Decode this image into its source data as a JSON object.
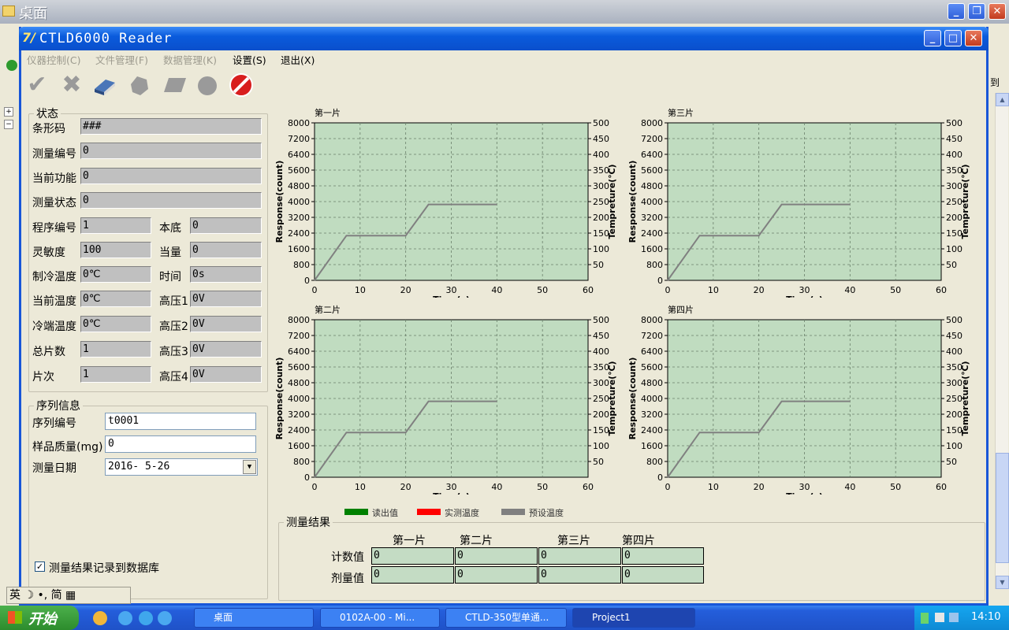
{
  "desktop": {
    "title": "桌面"
  },
  "app": {
    "title": "CTLD6000 Reader",
    "logo": "7/",
    "menu": [
      {
        "label": "仪器控制(C)",
        "enabled": false
      },
      {
        "label": "文件管理(F)",
        "enabled": false
      },
      {
        "label": "数据管理(K)",
        "enabled": false
      },
      {
        "label": "设置(S)",
        "enabled": true
      },
      {
        "label": "退出(X)",
        "enabled": true
      }
    ],
    "toolbar": [
      "check-icon",
      "cross-icon",
      "eraser-icon",
      "hand-icon",
      "plate-icon",
      "gear-icon",
      "stop-icon"
    ]
  },
  "status": {
    "legend": "状态",
    "fields": {
      "barcode": {
        "label": "条形码",
        "value": "###"
      },
      "measure_no": {
        "label": "测量编号",
        "value": "0"
      },
      "function": {
        "label": "当前功能",
        "value": "0"
      },
      "measure_state": {
        "label": "测量状态",
        "value": "0"
      },
      "program_no": {
        "label": "程序编号",
        "value": "1"
      },
      "background": {
        "label": "本底",
        "value": "0"
      },
      "sensitivity": {
        "label": "灵敏度",
        "value": "100"
      },
      "equivalent": {
        "label": "当量",
        "value": "0"
      },
      "cool_temp": {
        "label": "制冷温度",
        "value": "0℃"
      },
      "time": {
        "label": "时间",
        "value": "0s"
      },
      "cur_temp": {
        "label": "当前温度",
        "value": "0℃"
      },
      "hv1": {
        "label": "高压1",
        "value": "0V"
      },
      "cold_temp": {
        "label": "冷端温度",
        "value": "0℃"
      },
      "hv2": {
        "label": "高压2",
        "value": "0V"
      },
      "total": {
        "label": "总片数",
        "value": "1"
      },
      "hv3": {
        "label": "高压3",
        "value": "0V"
      },
      "piece": {
        "label": "片次",
        "value": "1"
      },
      "hv4": {
        "label": "高压4",
        "value": "0V"
      }
    }
  },
  "sequence": {
    "legend": "序列信息",
    "serial_label": "序列编号",
    "serial_value": "t0001",
    "mass_label": "样品质量(mg)",
    "mass_value": "0",
    "date_label": "测量日期",
    "date_value": "2016- 5-26"
  },
  "db_checkbox": {
    "label": "测量结果记录到数据库",
    "checked": true
  },
  "chart_data": [
    {
      "type": "line",
      "title": "第一片",
      "xlabel": "Time(s)",
      "ylabel": "Response(count)",
      "y2label": "Tempreture(℃)",
      "xlim": [
        0,
        60
      ],
      "ylim": [
        0,
        8000
      ],
      "y2lim": [
        0,
        500
      ],
      "xticks": [
        "0",
        "10",
        "20",
        "30",
        "40",
        "50",
        "60"
      ],
      "yticks": [
        "0",
        "800",
        "1600",
        "2400",
        "3200",
        "4000",
        "4800",
        "5600",
        "6400",
        "7200",
        "8000"
      ],
      "y2ticks": [
        "50",
        "100",
        "150",
        "200",
        "250",
        "300",
        "350",
        "400",
        "450",
        "500"
      ],
      "series": [
        {
          "name": "预设温度",
          "color": "#808080",
          "x": [
            0,
            7,
            20,
            25,
            40
          ],
          "y": [
            0,
            142,
            142,
            241,
            241
          ]
        }
      ]
    },
    {
      "type": "line",
      "title": "第三片",
      "xlabel": "Time(s)",
      "ylabel": "Response(count)",
      "y2label": "Tempreture(℃)",
      "xlim": [
        0,
        60
      ],
      "ylim": [
        0,
        8000
      ],
      "y2lim": [
        0,
        500
      ],
      "xticks": [
        "0",
        "10",
        "20",
        "30",
        "40",
        "50",
        "60"
      ],
      "yticks": [
        "0",
        "800",
        "1600",
        "2400",
        "3200",
        "4000",
        "4800",
        "5600",
        "6400",
        "7200",
        "8000"
      ],
      "y2ticks": [
        "50",
        "100",
        "150",
        "200",
        "250",
        "300",
        "350",
        "400",
        "450",
        "500"
      ],
      "series": [
        {
          "name": "预设温度",
          "color": "#808080",
          "x": [
            0,
            7,
            20,
            25,
            40
          ],
          "y": [
            0,
            142,
            142,
            241,
            241
          ]
        }
      ]
    },
    {
      "type": "line",
      "title": "第二片",
      "xlabel": "Time(s)",
      "ylabel": "Response(count)",
      "y2label": "Tempreture(℃)",
      "xlim": [
        0,
        60
      ],
      "ylim": [
        0,
        8000
      ],
      "y2lim": [
        0,
        500
      ],
      "xticks": [
        "0",
        "10",
        "20",
        "30",
        "40",
        "50",
        "60"
      ],
      "yticks": [
        "0",
        "800",
        "1600",
        "2400",
        "3200",
        "4000",
        "4800",
        "5600",
        "6400",
        "7200",
        "8000"
      ],
      "y2ticks": [
        "50",
        "100",
        "150",
        "200",
        "250",
        "300",
        "350",
        "400",
        "450",
        "500"
      ],
      "series": [
        {
          "name": "预设温度",
          "color": "#808080",
          "x": [
            0,
            7,
            20,
            25,
            40
          ],
          "y": [
            0,
            142,
            142,
            241,
            241
          ]
        }
      ]
    },
    {
      "type": "line",
      "title": "第四片",
      "xlabel": "Time(s)",
      "ylabel": "Response(count)",
      "y2label": "Tempreture(℃)",
      "xlim": [
        0,
        60
      ],
      "ylim": [
        0,
        8000
      ],
      "y2lim": [
        0,
        500
      ],
      "xticks": [
        "0",
        "10",
        "20",
        "30",
        "40",
        "50",
        "60"
      ],
      "yticks": [
        "0",
        "800",
        "1600",
        "2400",
        "3200",
        "4000",
        "4800",
        "5600",
        "6400",
        "7200",
        "8000"
      ],
      "y2ticks": [
        "50",
        "100",
        "150",
        "200",
        "250",
        "300",
        "350",
        "400",
        "450",
        "500"
      ],
      "series": [
        {
          "name": "预设温度",
          "color": "#808080",
          "x": [
            0,
            7,
            20,
            25,
            40
          ],
          "y": [
            0,
            142,
            142,
            241,
            241
          ]
        }
      ]
    }
  ],
  "legend": [
    {
      "label": "读出值",
      "color": "#008000"
    },
    {
      "label": "实测温度",
      "color": "#ff0000"
    },
    {
      "label": "预设温度",
      "color": "#808080"
    }
  ],
  "results": {
    "legend": "测量结果",
    "cols": [
      "第一片",
      "第二片",
      "第三片",
      "第四片"
    ],
    "count_label": "计数值",
    "count_values": [
      "0",
      "0",
      "0",
      "0"
    ],
    "dose_label": "剂量值",
    "dose_values": [
      "0",
      "0",
      "0",
      "0"
    ]
  },
  "taskbar": {
    "start": "开始",
    "tasks": [
      "桌面",
      "0102A-00 - Mi...",
      "CTLD-350型单通...",
      "Project1"
    ],
    "clock": "14:10"
  },
  "ime": {
    "text": "英 ☽ •, 简 ▦"
  },
  "bg": {
    "right_text": "到"
  }
}
